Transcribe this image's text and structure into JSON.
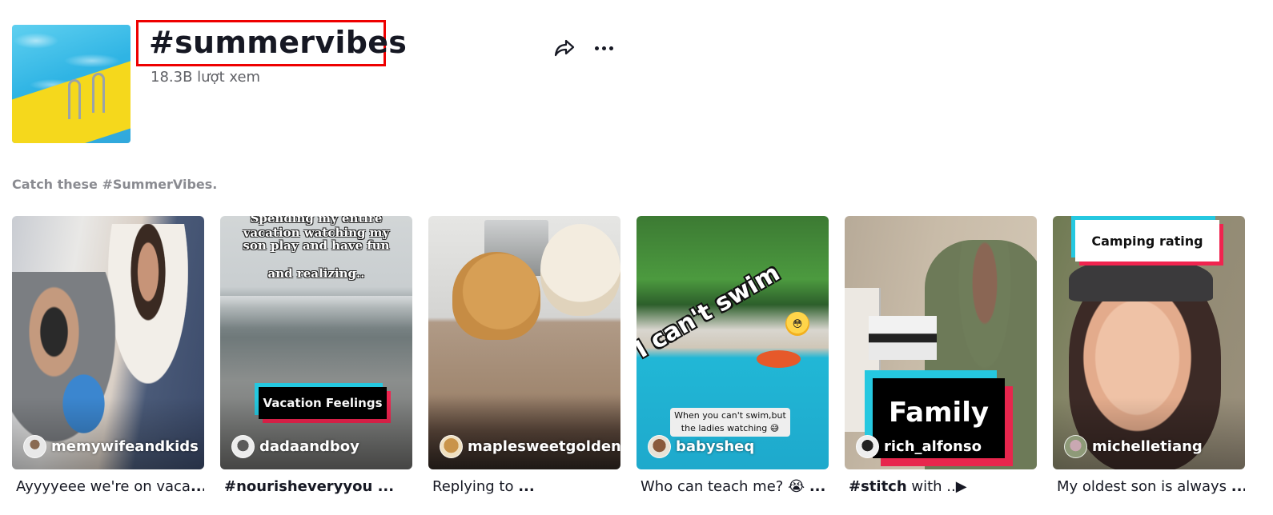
{
  "header": {
    "cover_icon": "hashtag-cover-image",
    "title": "#summervibes",
    "views": "18.3B lượt xem",
    "share_icon": "share-arrow-icon",
    "more_icon": "more-horizontal-icon"
  },
  "description": "Catch these #SummerVibes.",
  "videos": [
    {
      "author": "memywifeandkids",
      "caption_plain": "Ayyyyeee we're on vaca",
      "caption_ellipsis": "...",
      "overlay": {}
    },
    {
      "author": "dadaandboy",
      "caption_bold": "#nourisheveryyou ...",
      "overlay": {
        "top_text_1": "Spending my entire",
        "top_text_2": "vacation watching my",
        "top_text_3": "son play and have fun",
        "top_text_4": "and realizing..",
        "tag": "Vacation Feelings"
      }
    },
    {
      "author": "maplesweetgolden",
      "caption_plain": "Replying to ",
      "caption_ellipsis": "...",
      "overlay": {}
    },
    {
      "author": "babysheq",
      "caption_plain": "Who can teach me? 😭 ",
      "caption_ellipsis": "...",
      "overlay": {
        "big_text": "I can't swim",
        "emoji": "😳",
        "subtitle_1": "When you can't swim,but",
        "subtitle_2": "the ladies watching 😅"
      }
    },
    {
      "author": "rich_alfonso",
      "caption_bold": "#stitch",
      "caption_plain": " with ..▶",
      "overlay": {
        "tag": "Family"
      }
    },
    {
      "author": "michelletiang",
      "caption_plain": "My oldest son is always ",
      "caption_ellipsis": "...",
      "overlay": {
        "tag": "Camping rating"
      }
    }
  ]
}
